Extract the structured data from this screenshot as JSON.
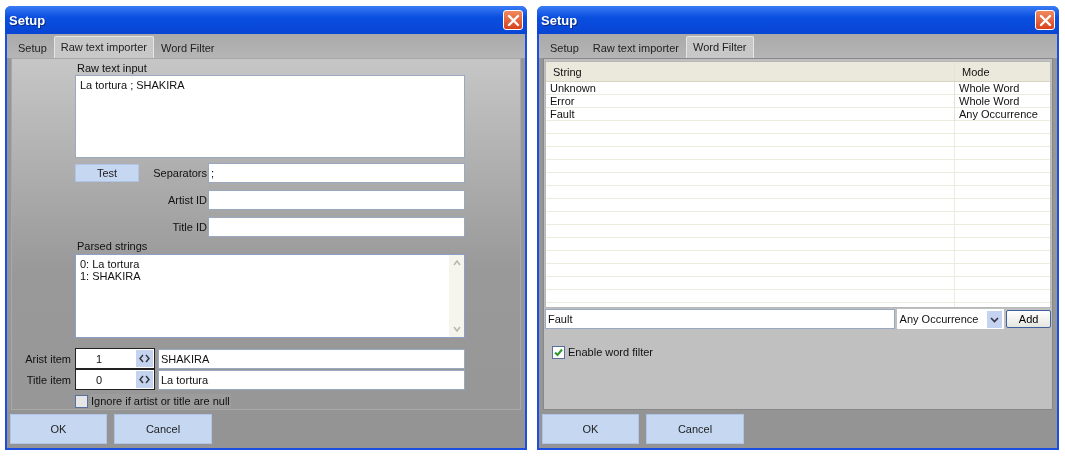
{
  "windows": [
    {
      "title": "Setup",
      "tabs": [
        {
          "label": "Setup",
          "selected": false
        },
        {
          "label": "Raw text importer",
          "selected": true
        },
        {
          "label": "Word Filter",
          "selected": false
        }
      ],
      "panel": {
        "kind": "raw_importer",
        "raw_input_label": "Raw text input",
        "raw_input_value": "La tortura ; SHAKIRA",
        "test_button": "Test",
        "fields": [
          {
            "label": "Separators",
            "value": ";"
          },
          {
            "label": "Artist ID"
          },
          {
            "label": "Title ID"
          }
        ],
        "parsed_label": "Parsed strings",
        "parsed_lines": [
          "0: La tortura",
          "1: SHAKIRA"
        ],
        "items": [
          {
            "label": "Arist item",
            "index": "1",
            "value": "SHAKIRA"
          },
          {
            "label": "Title item",
            "index": "0",
            "value": "La tortura"
          }
        ],
        "ignore_null": {
          "label": "Ignore if artist or title are null",
          "checked": false
        }
      },
      "buttons": [
        "OK",
        "Cancel"
      ]
    },
    {
      "title": "Setup",
      "tabs": [
        {
          "label": "Setup",
          "selected": false
        },
        {
          "label": "Raw text importer",
          "selected": false
        },
        {
          "label": "Word Filter",
          "selected": true
        }
      ],
      "panel": {
        "kind": "word_filter",
        "columns": [
          "String",
          "Mode"
        ],
        "rows": [
          {
            "string": "Unknown",
            "mode": "Whole Word"
          },
          {
            "string": "Error",
            "mode": "Whole Word"
          },
          {
            "string": "Fault",
            "mode": "Any Occurrence"
          }
        ],
        "new_string": "Fault",
        "mode_select": "Any Occurrence",
        "add_button": "Add",
        "enable": {
          "label": "Enable word filter",
          "checked": true
        }
      },
      "buttons": [
        "OK",
        "Cancel"
      ]
    }
  ]
}
